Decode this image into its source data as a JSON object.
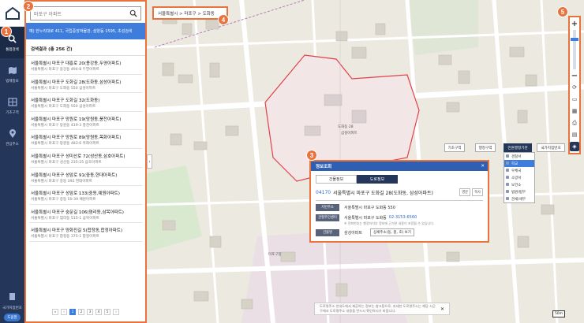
{
  "nav": {
    "items": [
      {
        "label": "통합검색"
      },
      {
        "label": "법제정보"
      },
      {
        "label": "기초구역"
      },
      {
        "label": "관심주소"
      }
    ],
    "bottom_label": "국가지점번호",
    "help_label": "도움말"
  },
  "search": {
    "placeholder": "마포구 아파트",
    "hint": "예) 한누리대로 411, 국립중앙박물관, 삼양동 1595, 초성검색",
    "result_label": "검색결과 (총 256 건)",
    "results": [
      {
        "title": "서울특별시 마포구 대흥로 20(용강동,두영아파트)",
        "sub": "서울특별시 마포구 용강동 494-8 두영아파트"
      },
      {
        "title": "서울특별시 마포구 도화길 28(도화동,삼성아파트)",
        "sub": "서울특별시 마포구 도화동 550 삼성아파트"
      },
      {
        "title": "서울특별시 마포구 도화길 32(도화동)",
        "sub": "서울특별시 마포구 도화동 550 삼성아파트"
      },
      {
        "title": "서울특별시 마포구 망원로 19(망원동,풍천아파트)",
        "sub": "서울특별시 마포구 망원동 419-3 풍천아파트"
      },
      {
        "title": "서울특별시 마포구 망원로 89(망원동,목화아파트)",
        "sub": "서울특별시 마포구 망원동 483-6 목화아파트"
      },
      {
        "title": "서울특별시 마포구 성미산로 72(성산동,삼호아파트)",
        "sub": "서울특별시 마포구 성산동 235-25 삼호아파트"
      },
      {
        "title": "서울특별시 마포구 성암로 91(중동,현대아파트)",
        "sub": "서울특별시 마포구 중동 392 현대아파트"
      },
      {
        "title": "서울특별시 마포구 성암로 133(중동,예원아파트)",
        "sub": "서울특별시 마포구 중동 50-39 예원아파트"
      },
      {
        "title": "서울특별시 마포구 숭문길 106(염리동,삼목아파트)",
        "sub": "서울특별시 마포구 염리동 515-1 삼목아파트"
      },
      {
        "title": "서울특별시 마포구 양화진길 5(합정동,합정아파트)",
        "sub": "서울특별시 마포구 합정동 375-1 합정아파트"
      }
    ],
    "pager": [
      "«",
      "‹",
      "1",
      "2",
      "3",
      "4",
      "5",
      "›"
    ],
    "current_page": "1"
  },
  "breadcrumb": "서울특별시 > 마포구 > 도화동",
  "badges": [
    "1",
    "2",
    "3",
    "4",
    "5"
  ],
  "map": {
    "buttons": [
      "기초구역",
      "행정구역",
      "민원행정기관",
      "국가지점번호"
    ],
    "layer_menu": [
      "경찰서",
      "학교",
      "우체국",
      "소방서",
      "보건소",
      "법원/법무",
      "관세/세무"
    ],
    "layer_selected": "학교",
    "labels": [
      "도화동 28",
      "삼성아파트",
      "마포구청"
    ],
    "scale": "50m",
    "notice": "도로명주소 안내도에서 제공하는 정보는 참고용으로, 자세한 도로명주소는 해당 시군구에서 도로명주소 내용을 반드시 확인하시기 바랍니다."
  },
  "dialog": {
    "title": "정보조회",
    "tabs": [
      "건물정보",
      "도로정보"
    ],
    "zip": "04170",
    "address": "서울특별시 마포구 도화길 28(도화동, 삼성아파트)",
    "btn_eng": "영문",
    "btn_copy": "복사",
    "rows": [
      {
        "k": "지번주소",
        "v": "서울특별시 마포구 도화동 550"
      },
      {
        "k": "관할주민센터",
        "v": "서울특별시 마포구 도화동",
        "phone": "02-3153-6560"
      },
      {
        "k": "건물명",
        "v": "삼성아파트"
      }
    ],
    "note": "※ 전화번호는 행정자치부 정보에 근거한 내용이 포함될 수 있습니다.",
    "select": "상세주소(동, 층, 호) 보기"
  },
  "colors": {
    "accent": "#e8733c",
    "nav": "#24375a",
    "primary": "#3e7ddb"
  }
}
